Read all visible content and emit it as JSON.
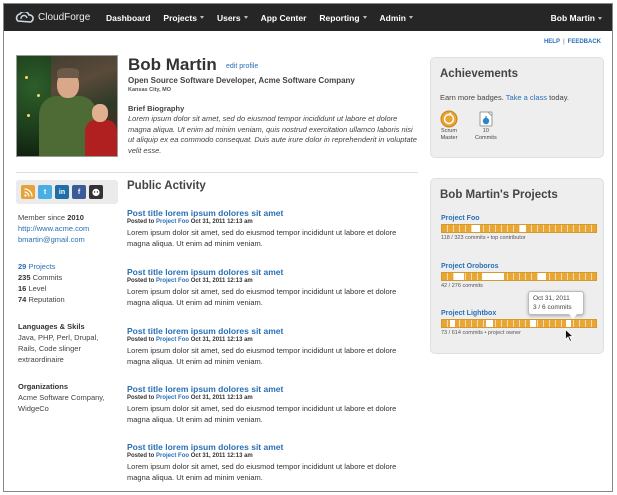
{
  "app": {
    "name": "CloudForge"
  },
  "nav": {
    "items": [
      {
        "label": "Dashboard",
        "dropdown": false
      },
      {
        "label": "Projects",
        "dropdown": true
      },
      {
        "label": "Users",
        "dropdown": true
      },
      {
        "label": "App Center",
        "dropdown": false
      },
      {
        "label": "Reporting",
        "dropdown": true
      },
      {
        "label": "Admin",
        "dropdown": true
      }
    ]
  },
  "user_menu": {
    "label": "Bob Martin"
  },
  "top_links": {
    "help": "HELP",
    "feedback": "FEEDBACK"
  },
  "profile": {
    "name": "Bob Martin",
    "edit_link": "edit profile",
    "role": "Open Source Software Developer, Acme Software Company",
    "location": "Kansas City, MO",
    "bio_heading": "Brief Biography",
    "bio": "Lorem ipsum dolor sit amet, sed do eiusmod tempor incididunt ut labore et dolore magna aliqua. Ut enim ad minim veniam, quis nostrud exercitation ullamco laboris nisi ut aliquip ex ea commodo consequat. Duis aute irure dolor in reprehenderit in voluptate velit esse."
  },
  "social": [
    "rss-icon",
    "twitter-icon",
    "linkedin-icon",
    "facebook-icon",
    "github-icon"
  ],
  "sidebar": {
    "member_since_label": "Member since",
    "member_since_year": "2010",
    "website": "http://www.acme.com",
    "email": "bmartin@gmail.com",
    "stats": {
      "projects_count": "29",
      "projects_label": "Projects",
      "commits_count": "235",
      "commits_label": "Commits",
      "level_count": "16",
      "level_label": "Level",
      "reputation_count": "74",
      "reputation_label": "Reputation"
    },
    "languages_heading": "Languages & Skils",
    "languages_text": "Java, PHP, Perl, Drupal, Rails, Code slinger extraordinaire",
    "orgs_heading": "Organizations",
    "orgs_text": "Acme Software Company, WidgeCo"
  },
  "activity": {
    "title": "Public Activity",
    "posts": [
      {
        "title": "Post title lorem ipsum dolores sit amet",
        "posted_to": "Posted to",
        "project": "Project Foo",
        "date": "Oct 31, 2011 12:13 am",
        "body": "Lorem ipsum dolor sit amet, sed do eiusmod tempor incididunt ut labore et dolore magna aliqua. Ut enim ad minim veniam."
      },
      {
        "title": "Post title lorem ipsum dolores sit amet",
        "posted_to": "Posted to",
        "project": "Project Foo",
        "date": "Oct 31, 2011 12:13 am",
        "body": "Lorem ipsum dolor sit amet, sed do eiusmod tempor incididunt ut labore et dolore magna aliqua. Ut enim ad minim veniam."
      },
      {
        "title": "Post title lorem ipsum dolores sit amet",
        "posted_to": "Posted to",
        "project": "Project Foo",
        "date": "Oct 31, 2011 12:13 am",
        "body": "Lorem ipsum dolor sit amet, sed do eiusmod tempor incididunt ut labore et dolore magna aliqua. Ut enim ad minim veniam."
      },
      {
        "title": "Post title lorem ipsum dolores sit amet",
        "posted_to": "Posted to",
        "project": "Project Foo",
        "date": "Oct 31, 2011 12:13 am",
        "body": "Lorem ipsum dolor sit amet, sed do eiusmod tempor incididunt ut labore et dolore magna aliqua. Ut enim ad minim veniam."
      },
      {
        "title": "Post title lorem ipsum dolores sit amet",
        "posted_to": "Posted to",
        "project": "Project Foo",
        "date": "Oct 31, 2011 12:13 am",
        "body": "Lorem ipsum dolor sit amet, sed do eiusmod tempor incididunt ut labore et dolore magna aliqua. Ut enim ad minim veniam."
      }
    ]
  },
  "achievements": {
    "title": "Achievements",
    "prompt": "Earn more badges.",
    "link": "Take a class",
    "prompt_end": "today.",
    "badges": [
      {
        "label1": "Scrum",
        "label2": "Master",
        "icon": "scrum-badge-icon"
      },
      {
        "label1": "10",
        "label2": "Commits",
        "icon": "commits-badge-icon"
      }
    ]
  },
  "projects": {
    "title": "Bob Martin's Projects",
    "items": [
      {
        "name": "Project Foo",
        "commits": "118",
        "total": "323",
        "commits_label": "commits",
        "role": "top contributor"
      },
      {
        "name": "Project Oroboros",
        "commits": "42",
        "total": "276",
        "commits_label": "commits",
        "role": ""
      },
      {
        "name": "Project Lightbox",
        "commits": "73",
        "total": "614",
        "commits_label": "commits",
        "role": "project owner"
      }
    ],
    "tooltip": {
      "date": "Oct 31, 2011",
      "value": "3 / 6 commits"
    }
  }
}
